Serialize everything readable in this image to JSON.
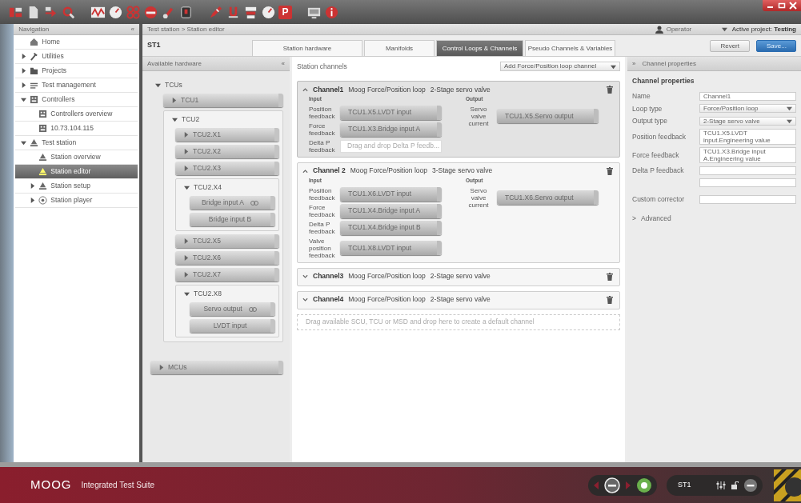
{
  "toolbar": [
    {
      "kind": "tree"
    },
    {
      "kind": "doc"
    },
    {
      "kind": "import"
    },
    {
      "kind": "search"
    },
    {
      "kind": "separator"
    },
    {
      "kind": "wave"
    },
    {
      "kind": "dial"
    },
    {
      "kind": "grid"
    },
    {
      "kind": "record"
    },
    {
      "kind": "brush"
    },
    {
      "kind": "stop"
    },
    {
      "kind": "separator"
    },
    {
      "kind": "pen"
    },
    {
      "kind": "magnet"
    },
    {
      "kind": "stack"
    },
    {
      "kind": "dial"
    },
    {
      "kind": "letter",
      "label": "P"
    },
    {
      "kind": "separator"
    },
    {
      "kind": "screen"
    },
    {
      "kind": "info"
    }
  ],
  "navigation": {
    "title": "Navigation",
    "collapse": "«",
    "items": [
      {
        "label": "Home",
        "kind": "home",
        "selected": false
      },
      {
        "label": "Utilities",
        "kind": "hammer",
        "expanded": false,
        "selected": false
      },
      {
        "label": "Projects",
        "kind": "folder",
        "expanded": false,
        "selected": false
      },
      {
        "label": "Test management",
        "kind": "list",
        "expanded": false,
        "selected": false
      },
      {
        "label": "Controllers",
        "kind": "controller",
        "expanded": true,
        "selected": false,
        "children": [
          {
            "label": "Controllers overview",
            "kind": "controller",
            "selected": false
          },
          {
            "label": "10.73.104.115",
            "kind": "controller",
            "selected": false
          }
        ]
      },
      {
        "label": "Test station",
        "kind": "station",
        "expanded": true,
        "selected": false,
        "children": [
          {
            "label": "Station overview",
            "kind": "station",
            "selected": false
          },
          {
            "label": "Station editor",
            "kind": "station",
            "selected": true
          },
          {
            "label": "Station setup",
            "kind": "station",
            "expanded": false,
            "selected": false
          },
          {
            "label": "Station player",
            "kind": "player",
            "expanded": false,
            "selected": false
          }
        ]
      }
    ]
  },
  "breadcrumb": "Test station > Station editor",
  "user": {
    "role": "Operator",
    "project": "Active project: **Testing**"
  },
  "station": "ST1",
  "tabs": [
    {
      "label": "Station hardware",
      "selected": false
    },
    {
      "label": "Manifolds",
      "selected": false
    },
    {
      "label": "Control Loops & Channels",
      "selected": true
    },
    {
      "label": "Pseudo Channels & Variables",
      "selected": false
    }
  ],
  "buttons": [
    {
      "label": "Revert",
      "kind": "default"
    },
    {
      "label": "Save...",
      "kind": "primary"
    }
  ],
  "hardware": {
    "title": "Available hardware",
    "collapse": "«",
    "items": [
      {
        "label": "TCUs",
        "expanded": true,
        "children": [
          {
            "label": "TCU1",
            "expanded": false
          },
          {
            "label": "TCU2",
            "expanded": true,
            "children": [
              {
                "label": "TCU2.X1",
                "expanded": false
              },
              {
                "label": "TCU2.X2",
                "expanded": false
              },
              {
                "label": "TCU2.X3",
                "expanded": false
              },
              {
                "label": "TCU2.X4",
                "expanded": true,
                "children": [
                  {
                    "label": "Bridge input A",
                    "linked": true
                  },
                  {
                    "label": "Bridge input B",
                    "linked": false
                  }
                ]
              },
              {
                "label": "TCU2.X5",
                "expanded": false
              },
              {
                "label": "TCU2.X6",
                "expanded": false
              },
              {
                "label": "TCU2.X7",
                "expanded": false
              },
              {
                "label": "TCU2.X8",
                "expanded": true,
                "children": [
                  {
                    "label": "Servo output",
                    "linked": true
                  },
                  {
                    "label": "LVDT input",
                    "linked": false
                  }
                ]
              }
            ]
          }
        ]
      },
      {
        "label": "MCUs",
        "expanded": false
      }
    ]
  },
  "channels_panel": {
    "title": "Station channels",
    "add_menu": "Add Force/Position loop channel",
    "drop_hint": "Drag available SCU, TCU or MSD and drop here to create a default channel"
  },
  "channels": [
    {
      "label": "Channel1",
      "loop": "Moog Force/Position loop",
      "valve": "2-Stage servo valve",
      "expanded": true,
      "selected": true,
      "input_title": "Input",
      "output_title": "Output",
      "inputs": [
        {
          "label": "Position feedback",
          "value": "TCU1.X5.LVDT input"
        },
        {
          "label": "Force feedback",
          "value": "TCU1.X3.Bridge input A"
        },
        {
          "label": "Delta P feedback",
          "placeholder": "Drag and drop Delta P feedb..."
        }
      ],
      "outputs": [
        {
          "label": "Servo valve current",
          "value": "TCU1.X5.Servo output"
        }
      ]
    },
    {
      "label": "Channel 2",
      "loop": "Moog Force/Position loop",
      "valve": "3-Stage servo valve",
      "expanded": true,
      "selected": false,
      "input_title": "Input",
      "output_title": "Output",
      "inputs": [
        {
          "label": "Position feedback",
          "value": "TCU1.X6.LVDT input"
        },
        {
          "label": "Force feedback",
          "value": "TCU1.X4.Bridge input A"
        },
        {
          "label": "Delta P feedback",
          "value": "TCU1.X4.Bridge input B"
        },
        {
          "label": "Valve position feedback",
          "value": "TCU1.X8.LVDT input"
        }
      ],
      "outputs": [
        {
          "label": "Servo valve current",
          "value": "TCU1.X6.Servo output"
        }
      ]
    },
    {
      "label": "Channel3",
      "loop": "Moog Force/Position loop",
      "valve": "2-Stage servo valve",
      "expanded": false,
      "selected": false
    },
    {
      "label": "Channel4",
      "loop": "Moog Force/Position loop",
      "valve": "2-Stage servo valve",
      "expanded": false,
      "selected": false
    }
  ],
  "properties": {
    "header": "Channel properties",
    "expand": "»",
    "title": "Channel properties",
    "fields": [
      {
        "label": "Name",
        "kind": "input",
        "value": "Channel1"
      },
      {
        "label": "Loop type",
        "kind": "select",
        "value": "Force/Position loop"
      },
      {
        "label": "Output type",
        "kind": "select",
        "value": "2-Stage servo valve"
      },
      {
        "label": "Position feedback",
        "kind": "textarea",
        "value": "TCU1.X5.LVDT input.Engineering value"
      },
      {
        "label": "Force feedback",
        "kind": "textarea",
        "value": "TCU1.X3.Bridge input A.Engineering value"
      },
      {
        "label": "Delta P feedback",
        "kind": "input"
      },
      {
        "kind": "input"
      },
      {
        "label": "Custom corrector",
        "kind": "input"
      }
    ],
    "advanced": {
      "label": "Advanced",
      "glyph": ">",
      "expanded": false
    }
  },
  "footer": {
    "brand": "MOOG",
    "product": "Integrated Test Suite",
    "station": "ST1"
  }
}
